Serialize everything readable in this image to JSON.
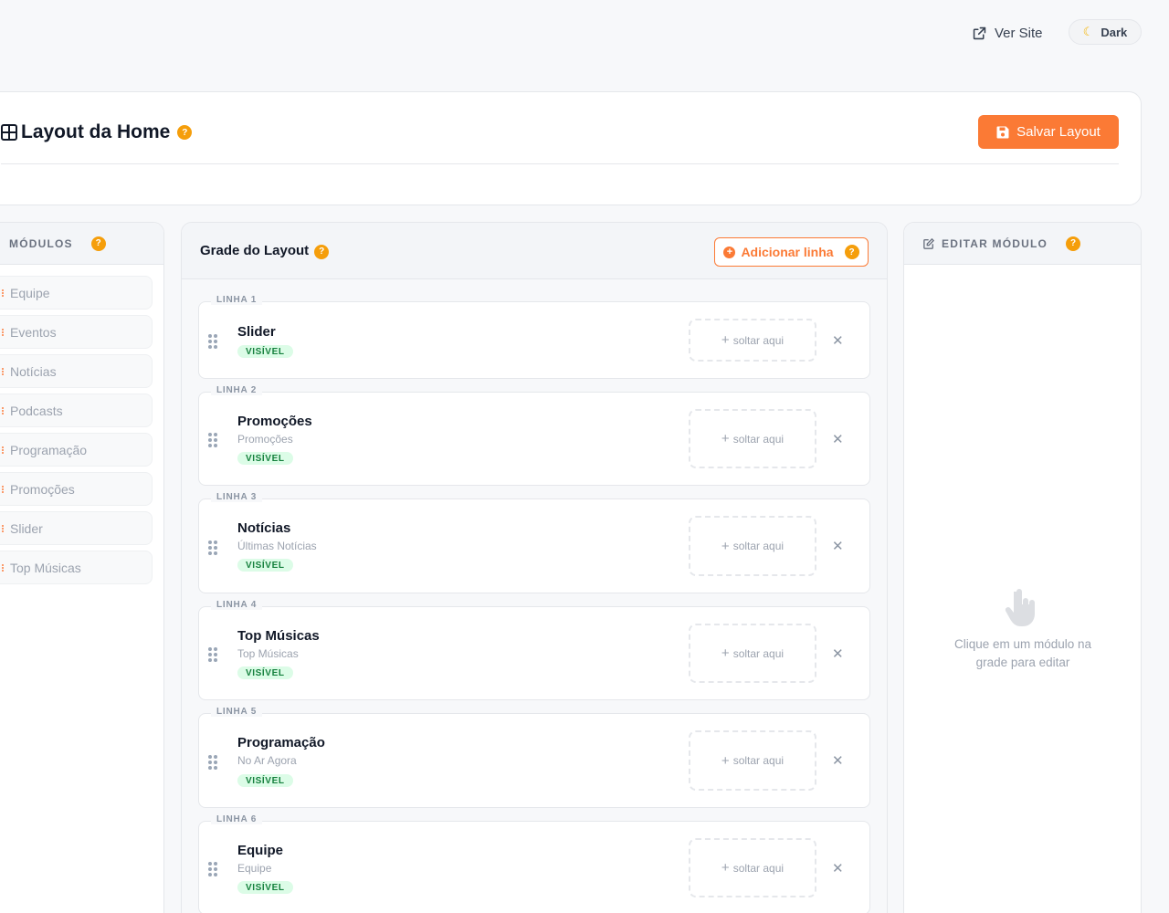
{
  "topbar": {
    "ver_site_label": "Ver Site",
    "theme_label": "Dark"
  },
  "header": {
    "title": "Layout da Home",
    "help_mark": "?",
    "save_label": "Salvar Layout"
  },
  "modules_panel": {
    "title": "MÓDULOS",
    "help_mark": "?",
    "items": [
      "Equipe",
      "Eventos",
      "Notícias",
      "Podcasts",
      "Programação",
      "Promoções",
      "Slider",
      "Top Músicas"
    ]
  },
  "grid_panel": {
    "title": "Grade do Layout",
    "help_mark": "?",
    "add_row_label": "Adicionar linha",
    "drop_label": "soltar aqui",
    "rows": [
      {
        "label": "LINHA 1",
        "name": "Slider",
        "subtitle": "",
        "status": "VISÍVEL"
      },
      {
        "label": "LINHA 2",
        "name": "Promoções",
        "subtitle": "Promoções",
        "status": "VISÍVEL"
      },
      {
        "label": "LINHA 3",
        "name": "Notícias",
        "subtitle": "Últimas Notícias",
        "status": "VISÍVEL"
      },
      {
        "label": "LINHA 4",
        "name": "Top Músicas",
        "subtitle": "Top Músicas",
        "status": "VISÍVEL"
      },
      {
        "label": "LINHA 5",
        "name": "Programação",
        "subtitle": "No Ar Agora",
        "status": "VISÍVEL"
      },
      {
        "label": "LINHA 6",
        "name": "Equipe",
        "subtitle": "Equipe",
        "status": "VISÍVEL"
      }
    ]
  },
  "editor_panel": {
    "title": "EDITAR MÓDULO",
    "help_mark": "?",
    "hint": "Clique em um módulo na grade para editar"
  },
  "colors": {
    "accent": "#fb7a35",
    "help": "#f59e0b",
    "visible_bg": "#dcfce7",
    "visible_text": "#15803d"
  }
}
